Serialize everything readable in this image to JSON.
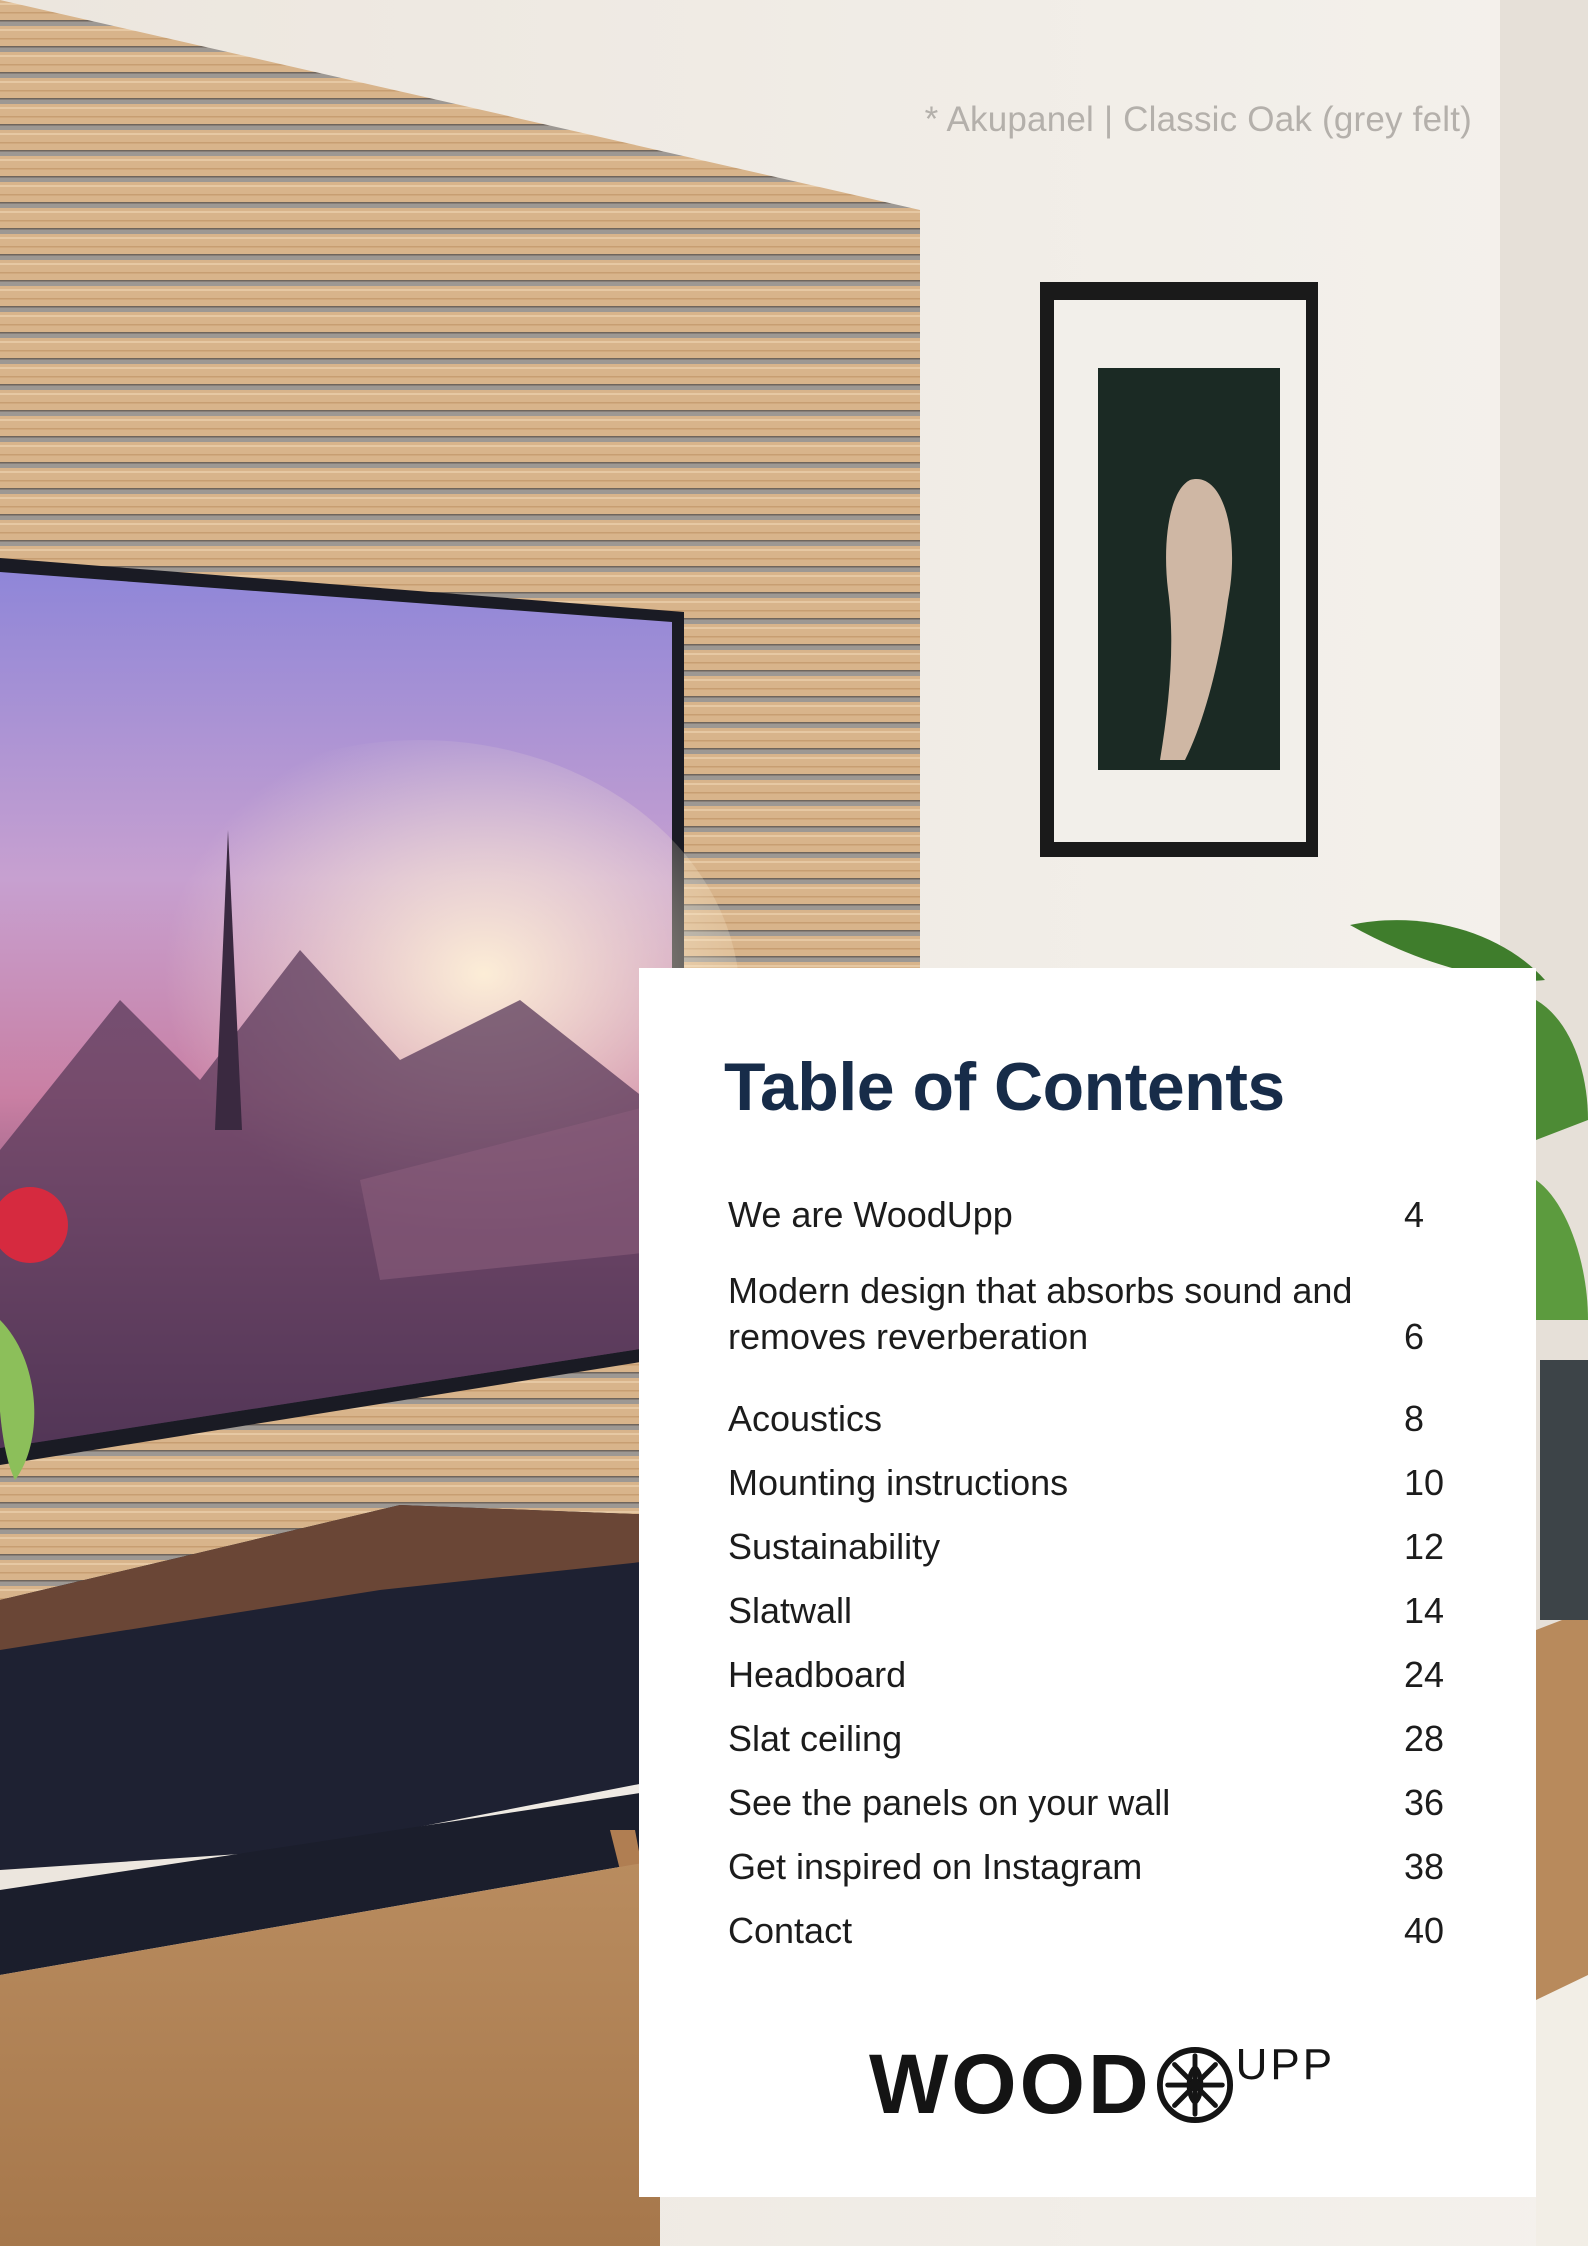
{
  "photo_caption": "* Akupanel | Classic Oak (grey felt)",
  "toc": {
    "title": "Table of Contents",
    "items": [
      {
        "title": "We are WoodUpp",
        "page": "4"
      },
      {
        "title": "Modern design that absorbs sound and removes reverberation",
        "page": "6"
      },
      {
        "title": "Acoustics",
        "page": "8"
      },
      {
        "title": "Mounting instructions",
        "page": "10"
      },
      {
        "title": "Sustainability",
        "page": "12"
      },
      {
        "title": "Slatwall",
        "page": "14"
      },
      {
        "title": "Headboard",
        "page": "24"
      },
      {
        "title": "Slat ceiling",
        "page": "28"
      },
      {
        "title": "See the panels on your wall",
        "page": "36"
      },
      {
        "title": "Get inspired on Instagram",
        "page": "38"
      },
      {
        "title": "Contact",
        "page": "40"
      }
    ]
  },
  "logo": {
    "main": "WOOD",
    "sub": "UPP"
  },
  "colors": {
    "title": "#172c49",
    "text": "#1c1c1c",
    "caption": "#b4b0ab"
  }
}
